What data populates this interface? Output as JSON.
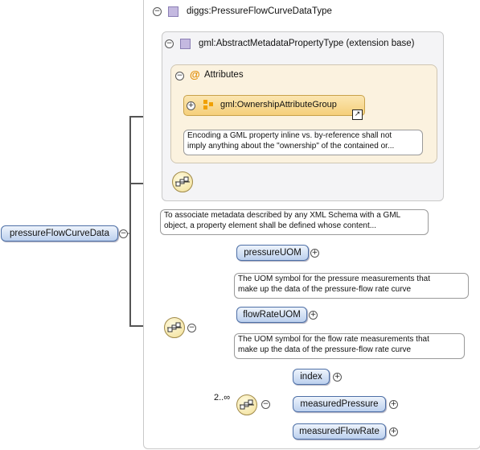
{
  "type_box": {
    "label": "diggs:PressureFlowCurveDataType"
  },
  "extension_box": {
    "label": "gml:AbstractMetadataPropertyType (extension base)"
  },
  "attributes": {
    "label": "Attributes",
    "group": {
      "label": "gml:OwnershipAttributeGroup"
    },
    "group_note": {
      "line1": "Encoding a GML property inline vs. by-reference shall not",
      "line2": "imply anything about the \"ownership\" of the contained or..."
    }
  },
  "extension_note": {
    "line1": "To associate metadata described by any XML Schema with a GML",
    "line2": "object, a property element shall be defined whose content..."
  },
  "root_element": {
    "label": "pressureFlowCurveData"
  },
  "elements": {
    "pressureUOM": {
      "label": "pressureUOM",
      "note_line1": "The UOM symbol for the pressure measurements that",
      "note_line2": "make up the data of the pressure-flow rate curve"
    },
    "flowRateUOM": {
      "label": "flowRateUOM",
      "note_line1": "The UOM symbol for the flow rate measurements that",
      "note_line2": "make up the data of the pressure-flow rate curve"
    },
    "index": {
      "label": "index"
    },
    "measuredPressure": {
      "label": "measuredPressure"
    },
    "measuredFlowRate": {
      "label": "measuredFlowRate"
    }
  },
  "inner_sequence": {
    "multiplicity": "2..∞"
  },
  "toggles": {
    "collapse": "−",
    "expand": "+"
  },
  "icons": {
    "type": "complex-type-icon",
    "attributes": "at-sign-icon",
    "group": "attribute-group-icon",
    "sequence": "sequence-compositor-icon",
    "link": "external-link-icon"
  },
  "colors": {
    "element_fill": "#bcd0ee",
    "element_border": "#4d6fa6",
    "attribute_bg": "#fbf2df",
    "group_fill": "#f5cf7a",
    "type_square": "#c4b9e0",
    "connector": "#555555"
  }
}
